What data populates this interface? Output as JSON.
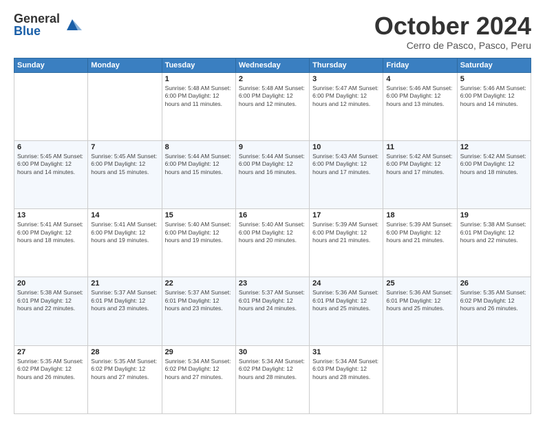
{
  "header": {
    "logo_general": "General",
    "logo_blue": "Blue",
    "month_title": "October 2024",
    "location": "Cerro de Pasco, Pasco, Peru"
  },
  "weekdays": [
    "Sunday",
    "Monday",
    "Tuesday",
    "Wednesday",
    "Thursday",
    "Friday",
    "Saturday"
  ],
  "weeks": [
    [
      {
        "day": "",
        "info": ""
      },
      {
        "day": "",
        "info": ""
      },
      {
        "day": "1",
        "info": "Sunrise: 5:48 AM\nSunset: 6:00 PM\nDaylight: 12 hours and 11 minutes."
      },
      {
        "day": "2",
        "info": "Sunrise: 5:48 AM\nSunset: 6:00 PM\nDaylight: 12 hours and 12 minutes."
      },
      {
        "day": "3",
        "info": "Sunrise: 5:47 AM\nSunset: 6:00 PM\nDaylight: 12 hours and 12 minutes."
      },
      {
        "day": "4",
        "info": "Sunrise: 5:46 AM\nSunset: 6:00 PM\nDaylight: 12 hours and 13 minutes."
      },
      {
        "day": "5",
        "info": "Sunrise: 5:46 AM\nSunset: 6:00 PM\nDaylight: 12 hours and 14 minutes."
      }
    ],
    [
      {
        "day": "6",
        "info": "Sunrise: 5:45 AM\nSunset: 6:00 PM\nDaylight: 12 hours and 14 minutes."
      },
      {
        "day": "7",
        "info": "Sunrise: 5:45 AM\nSunset: 6:00 PM\nDaylight: 12 hours and 15 minutes."
      },
      {
        "day": "8",
        "info": "Sunrise: 5:44 AM\nSunset: 6:00 PM\nDaylight: 12 hours and 15 minutes."
      },
      {
        "day": "9",
        "info": "Sunrise: 5:44 AM\nSunset: 6:00 PM\nDaylight: 12 hours and 16 minutes."
      },
      {
        "day": "10",
        "info": "Sunrise: 5:43 AM\nSunset: 6:00 PM\nDaylight: 12 hours and 17 minutes."
      },
      {
        "day": "11",
        "info": "Sunrise: 5:42 AM\nSunset: 6:00 PM\nDaylight: 12 hours and 17 minutes."
      },
      {
        "day": "12",
        "info": "Sunrise: 5:42 AM\nSunset: 6:00 PM\nDaylight: 12 hours and 18 minutes."
      }
    ],
    [
      {
        "day": "13",
        "info": "Sunrise: 5:41 AM\nSunset: 6:00 PM\nDaylight: 12 hours and 18 minutes."
      },
      {
        "day": "14",
        "info": "Sunrise: 5:41 AM\nSunset: 6:00 PM\nDaylight: 12 hours and 19 minutes."
      },
      {
        "day": "15",
        "info": "Sunrise: 5:40 AM\nSunset: 6:00 PM\nDaylight: 12 hours and 19 minutes."
      },
      {
        "day": "16",
        "info": "Sunrise: 5:40 AM\nSunset: 6:00 PM\nDaylight: 12 hours and 20 minutes."
      },
      {
        "day": "17",
        "info": "Sunrise: 5:39 AM\nSunset: 6:00 PM\nDaylight: 12 hours and 21 minutes."
      },
      {
        "day": "18",
        "info": "Sunrise: 5:39 AM\nSunset: 6:00 PM\nDaylight: 12 hours and 21 minutes."
      },
      {
        "day": "19",
        "info": "Sunrise: 5:38 AM\nSunset: 6:01 PM\nDaylight: 12 hours and 22 minutes."
      }
    ],
    [
      {
        "day": "20",
        "info": "Sunrise: 5:38 AM\nSunset: 6:01 PM\nDaylight: 12 hours and 22 minutes."
      },
      {
        "day": "21",
        "info": "Sunrise: 5:37 AM\nSunset: 6:01 PM\nDaylight: 12 hours and 23 minutes."
      },
      {
        "day": "22",
        "info": "Sunrise: 5:37 AM\nSunset: 6:01 PM\nDaylight: 12 hours and 23 minutes."
      },
      {
        "day": "23",
        "info": "Sunrise: 5:37 AM\nSunset: 6:01 PM\nDaylight: 12 hours and 24 minutes."
      },
      {
        "day": "24",
        "info": "Sunrise: 5:36 AM\nSunset: 6:01 PM\nDaylight: 12 hours and 25 minutes."
      },
      {
        "day": "25",
        "info": "Sunrise: 5:36 AM\nSunset: 6:01 PM\nDaylight: 12 hours and 25 minutes."
      },
      {
        "day": "26",
        "info": "Sunrise: 5:35 AM\nSunset: 6:02 PM\nDaylight: 12 hours and 26 minutes."
      }
    ],
    [
      {
        "day": "27",
        "info": "Sunrise: 5:35 AM\nSunset: 6:02 PM\nDaylight: 12 hours and 26 minutes."
      },
      {
        "day": "28",
        "info": "Sunrise: 5:35 AM\nSunset: 6:02 PM\nDaylight: 12 hours and 27 minutes."
      },
      {
        "day": "29",
        "info": "Sunrise: 5:34 AM\nSunset: 6:02 PM\nDaylight: 12 hours and 27 minutes."
      },
      {
        "day": "30",
        "info": "Sunrise: 5:34 AM\nSunset: 6:02 PM\nDaylight: 12 hours and 28 minutes."
      },
      {
        "day": "31",
        "info": "Sunrise: 5:34 AM\nSunset: 6:03 PM\nDaylight: 12 hours and 28 minutes."
      },
      {
        "day": "",
        "info": ""
      },
      {
        "day": "",
        "info": ""
      }
    ]
  ]
}
